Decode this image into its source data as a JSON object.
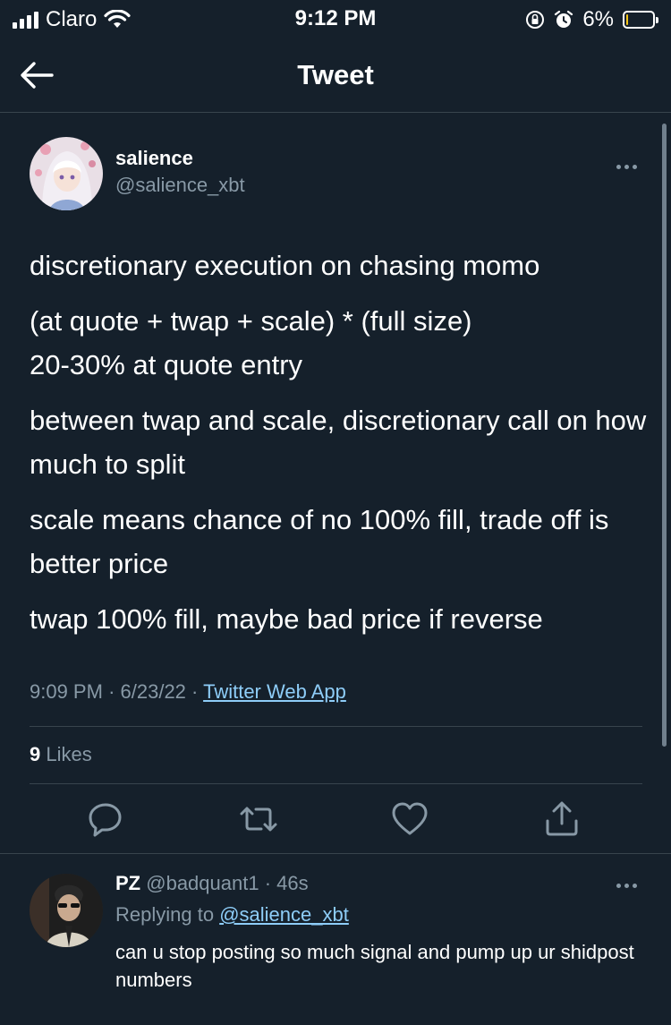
{
  "status_bar": {
    "carrier": "Claro",
    "time": "9:12 PM",
    "battery": "6%",
    "battery_level": 0.06
  },
  "nav": {
    "title": "Tweet"
  },
  "tweet": {
    "author_name": "salience",
    "author_handle": "@salience_xbt",
    "paragraphs": [
      "discretionary execution on chasing momo",
      "(at quote + twap + scale) * (full size)\n20-30% at quote entry",
      "between twap and scale, discretionary call on how much to split",
      "scale means chance of no 100% fill, trade off is better price",
      "twap 100% fill, maybe bad price if reverse"
    ],
    "time": "9:09 PM",
    "sep1": "·",
    "date": "6/23/22",
    "sep2": "·",
    "source": "Twitter Web App",
    "likes_count": "9",
    "likes_label": "Likes"
  },
  "reply": {
    "author_name": "PZ",
    "author_handle": "@badquant1",
    "sep": "·",
    "age": "46s",
    "replying_label": "Replying to",
    "replying_to": "@salience_xbt",
    "text": "can u stop posting so much signal and pump up ur shidpost numbers"
  },
  "colors": {
    "background": "#15202b",
    "secondary_text": "#8899a6",
    "link": "#8ecdf8",
    "divider": "#38444d"
  }
}
